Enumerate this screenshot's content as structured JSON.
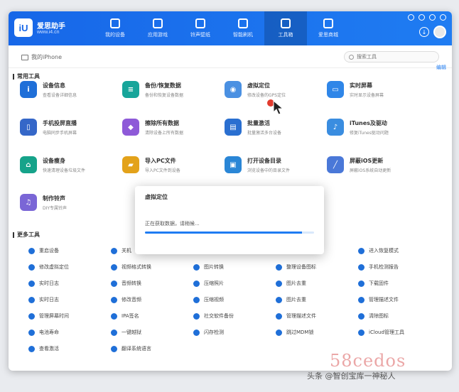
{
  "app": {
    "logo_text": "iU",
    "name": "爱思助手",
    "url": "www.i4.cn"
  },
  "nav_tabs": [
    {
      "label": "我的设备"
    },
    {
      "label": "应用游戏"
    },
    {
      "label": "铃声壁纸"
    },
    {
      "label": "智能刷机"
    },
    {
      "label": "工具箱"
    },
    {
      "label": "爱思商城"
    }
  ],
  "device_info": "我的iPhone",
  "search": {
    "placeholder": "搜索工具"
  },
  "sections": {
    "common_tools": "常用工具",
    "more_tools": "更多工具",
    "edit": "编辑"
  },
  "tools": [
    {
      "name": "设备信息",
      "desc": "查看设备详细信息",
      "color": "#1f6fd8",
      "glyph": "i"
    },
    {
      "name": "备份/恢复数据",
      "desc": "备份和恢复设备数据",
      "color": "#17a59a",
      "glyph": "≡"
    },
    {
      "name": "虚拟定位",
      "desc": "修改设备的GPS定位",
      "color": "#4a90e2",
      "glyph": "◉"
    },
    {
      "name": "实时屏幕",
      "desc": "实时显示设备屏幕",
      "color": "#2f86e8",
      "glyph": "▭"
    },
    {
      "name": "手机投屏直播",
      "desc": "电脑同步手机屏幕",
      "color": "#3567c8",
      "glyph": "▯"
    },
    {
      "name": "擦除所有数据",
      "desc": "清除设备上所有数据",
      "color": "#8e5ad8",
      "glyph": "◆"
    },
    {
      "name": "批量激活",
      "desc": "批量激活多台设备",
      "color": "#2a6fd0",
      "glyph": "▤"
    },
    {
      "name": "iTunes及驱动",
      "desc": "修复iTunes驱动问题",
      "color": "#3a8de0",
      "glyph": "♪"
    },
    {
      "name": "设备瘦身",
      "desc": "快速清理设备垃圾文件",
      "color": "#16a38a",
      "glyph": "⌂"
    },
    {
      "name": "导入PC文件",
      "desc": "导入PC文件到设备",
      "color": "#e3a21a",
      "glyph": "▰"
    },
    {
      "name": "打开设备目录",
      "desc": "浏览设备中的目录文件",
      "color": "#2a86d6",
      "glyph": "▣"
    },
    {
      "name": "屏蔽iOS更新",
      "desc": "屏蔽iOS系统自动更新",
      "color": "#4a78d8",
      "glyph": "╱"
    },
    {
      "name": "制作铃声",
      "desc": "DIY专属铃声",
      "color": "#7a66d6",
      "glyph": "♫"
    }
  ],
  "more_tools": [
    {
      "label": "重启设备"
    },
    {
      "label": "关机"
    },
    {
      "label": ""
    },
    {
      "label": ""
    },
    {
      "label": "进入恢复模式"
    },
    {
      "label": "修改虚拟定位"
    },
    {
      "label": "视频格式转换"
    },
    {
      "label": "图片转换"
    },
    {
      "label": "整理设备图标"
    },
    {
      "label": "手机检测报告"
    },
    {
      "label": "实时日志"
    },
    {
      "label": "音频转换"
    },
    {
      "label": "压缩照片"
    },
    {
      "label": "图片去重"
    },
    {
      "label": "下载固件"
    },
    {
      "label": "实时日志"
    },
    {
      "label": "修改音频"
    },
    {
      "label": "压缩视频"
    },
    {
      "label": "图片去重"
    },
    {
      "label": "管理描述文件"
    },
    {
      "label": "管理屏幕时间"
    },
    {
      "label": "IPA签名"
    },
    {
      "label": "社交软件备份"
    },
    {
      "label": "管理描述文件"
    },
    {
      "label": "清除图标"
    },
    {
      "label": "电池寿命"
    },
    {
      "label": "一键越狱"
    },
    {
      "label": "闪存检测"
    },
    {
      "label": "跳过MDM锁"
    },
    {
      "label": "iCloud管理工具"
    },
    {
      "label": "查看激活"
    },
    {
      "label": "翻译系统语言"
    }
  ],
  "dialog": {
    "title": "虚拟定位",
    "status": "正在获取数据，请稍候...",
    "progress": 0.93
  },
  "watermark": {
    "code": "58cedos",
    "text": "头条 @智创宝库一神秘人"
  }
}
